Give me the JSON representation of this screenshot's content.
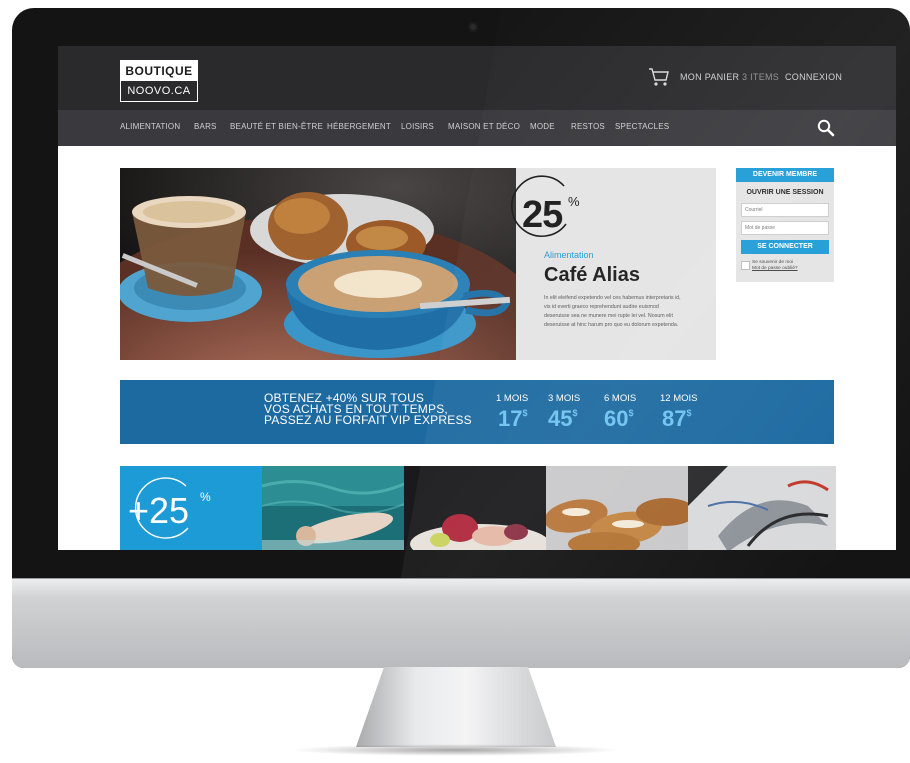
{
  "header": {
    "logo_line1": "BOUTIQUE",
    "logo_line2": "NOOVO.CA",
    "cart_label": "MON PANIER",
    "items_label": "3 ITEMS",
    "login_label": "CONNEXION"
  },
  "nav": {
    "items": [
      {
        "label": "ALIMENTATION"
      },
      {
        "label": "BARS"
      },
      {
        "label": "BEAUTÉ ET BIEN-ÊTRE"
      },
      {
        "label": "HÉBERGEMENT"
      },
      {
        "label": "LOISIRS"
      },
      {
        "label": "MAISON ET DÉCO"
      },
      {
        "label": "MODE"
      },
      {
        "label": "RESTOS"
      },
      {
        "label": "SPECTACLES"
      }
    ]
  },
  "hero": {
    "discount": "25",
    "percent": "%",
    "category": "Alimentation",
    "title": "Café Alias",
    "description": "In elit eleifend expetendo vel ces habemus interpretaris id, vis id everti graeco reprehendunt audire euismod deseruisse sea ne munere mei rupte lei vel. Nosum elit deseruisse at hinc harum pro quo eu dolorum expetenda."
  },
  "login": {
    "become_member": "DEVENIR MEMBRE",
    "heading": "OUVRIR UNE SESSION",
    "email_placeholder": "Courriel",
    "password_placeholder": "Mot de passe",
    "connect_button": "SE CONNECTER",
    "remember": "Se souvenir de moi",
    "forgot": "Mot de passe oublié?"
  },
  "banner": {
    "line1": "OBTENEZ +40% SUR TOUS",
    "line2": "VOS ACHATS EN TOUT TEMPS,",
    "line3": "PASSEZ AU FORFAIT VIP EXPRESS",
    "plans": [
      {
        "label": "1 MOIS",
        "price": "17",
        "currency": "$"
      },
      {
        "label": "3 MOIS",
        "price": "45",
        "currency": "$"
      },
      {
        "label": "6 MOIS",
        "price": "60",
        "currency": "$"
      },
      {
        "label": "12 MOIS",
        "price": "87",
        "currency": "$"
      }
    ]
  },
  "tiles": {
    "promo_value": "+25",
    "promo_percent": "%"
  },
  "colors": {
    "accent": "#1d9bd6",
    "banner": "#1d6aa1",
    "topbar": "#2a2a2d",
    "navbar": "#3a3a3e"
  }
}
